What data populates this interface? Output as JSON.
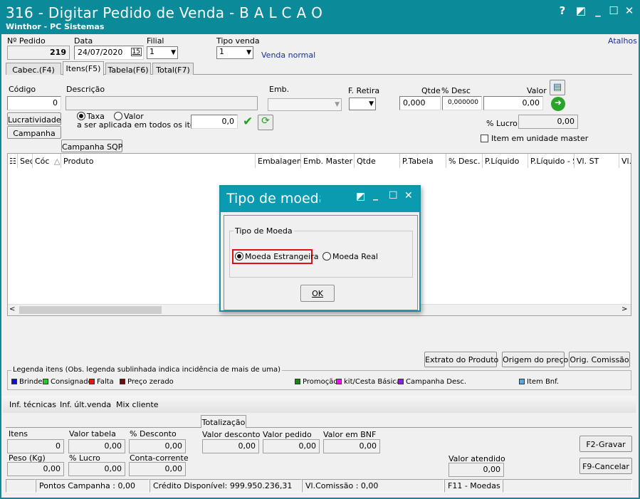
{
  "window": {
    "title": "316 - Digitar Pedido de Venda - B A L C A O",
    "subtitle": "Winthor - PC Sistemas",
    "help_glyph": "?",
    "restore_glyph": "◩",
    "minimize_glyph": "_",
    "maximize_glyph": "☐",
    "close_glyph": "✕"
  },
  "header": {
    "pedido_label": "Nº Pedido",
    "pedido_value": "219",
    "data_label": "Data",
    "data_value": "24/07/2020",
    "calendar_glyph": "15",
    "filial_label": "Filial",
    "filial_value": "1",
    "tipo_venda_label": "Tipo venda",
    "tipo_venda_value": "1",
    "tipo_venda_desc": "Venda normal",
    "atalhos": "Atalhos"
  },
  "tabs": [
    {
      "label": "Cabec.(F4)"
    },
    {
      "label": "Itens(F5)"
    },
    {
      "label": "Tabela(F6)"
    },
    {
      "label": "Total(F7)"
    }
  ],
  "item_form": {
    "codigo_label": "Código",
    "codigo_value": "0",
    "descricao_label": "Descrição",
    "emb_label": "Emb.",
    "f_retira_label": "F. Retira",
    "qtde_label": "Qtde",
    "qtde_value": "0,000",
    "desc_label": "% Desc",
    "desc_value": "0,000000",
    "valor_label": "Valor",
    "valor_value": "0,00",
    "lucro_label": "% Lucro:",
    "lucro_value": "0,00",
    "item_master_label": "Item em unidade master",
    "lucratividade_button": "Lucratividade",
    "campanha_button": "Campanha",
    "campanha_sqp_button": "Campanha SQP",
    "taxa_label": "Taxa",
    "valor_radio_label": "Valor",
    "aplicada_label": "a ser aplicada em todos os itens:",
    "taxa_value": "0,0",
    "check_glyph": "✔",
    "refresh_glyph": "⟳",
    "copy_glyph": "▤",
    "go_glyph": "➜"
  },
  "grid": {
    "columns": [
      "Sec",
      "Cóc",
      "Produto",
      "Embalagem",
      "Emb. Master",
      "Qtde",
      "P.Tabela",
      "% Desc.",
      "P.Líquido",
      "P.Líquido - S",
      "Vl. ST",
      "Vl."
    ],
    "sort_glyph": "△",
    "menu_glyph": "☷",
    "scroll_left": "<",
    "scroll_right": ">"
  },
  "actions": {
    "extrato": "Extrato do Produto",
    "origem": "Origem do preço",
    "comissao": "Orig. Comissão"
  },
  "legend": {
    "title": "Legenda itens (Obs. legenda sublinhada indica incidência de mais de uma)",
    "items": [
      {
        "label": "Brinde",
        "color": "#1010d0"
      },
      {
        "label": "Consignado",
        "color": "#22cc22"
      },
      {
        "label": "Falta",
        "color": "#ee1111"
      },
      {
        "label": "Preço zerado",
        "color": "#7a0a0a"
      },
      {
        "label": "Promoção",
        "color": "#118811"
      },
      {
        "label": "kit/Cesta Básica",
        "color": "#ee11ee"
      },
      {
        "label": "Campanha Desc.",
        "color": "#8a22dd"
      },
      {
        "label": "Item Bnf.",
        "color": "#55a8e8"
      }
    ]
  },
  "info_links": [
    "Inf. técnicas",
    "Inf. últ.venda",
    "Mix cliente"
  ],
  "totals": {
    "tab_label": "Totalização",
    "itens_label": "Itens",
    "itens_value": "0",
    "valor_tabela_label": "Valor tabela",
    "valor_tabela_value": "0,00",
    "pct_desconto_label": "% Desconto",
    "pct_desconto_value": "0,00",
    "valor_desconto_label": "Valor desconto",
    "valor_desconto_value": "0,00",
    "valor_pedido_label": "Valor pedido",
    "valor_pedido_value": "0,00",
    "valor_bnf_label": "Valor em BNF",
    "valor_bnf_value": "0,00",
    "peso_label": "Peso (Kg)",
    "peso_value": "0,00",
    "pct_lucro_label": "% Lucro",
    "pct_lucro_value": "0,00",
    "conta_corrente_label": "Conta-corrente",
    "conta_corrente_value": "0,00",
    "valor_atendido_label": "Valor atendido",
    "valor_atendido_value": "0,00",
    "gravar_button": "F2-Gravar",
    "cancelar_button": "F9-Cancelar"
  },
  "status_bar": {
    "pontos": "Pontos Campanha : 0,00",
    "credito": "Crédito Disponível: 999.950.236,31",
    "comissao": "Vl.Comissão : 0,00",
    "moedas": "F11 - Moedas"
  },
  "dialog": {
    "title": "Tipo de moeda",
    "group_label": "Tipo de Moeda",
    "option_estrangeira": "Moeda Estrangeira",
    "option_real": "Moeda Real",
    "selected": "Moeda Estrangeira",
    "ok_button": "OK",
    "highlight_color": "#e01010"
  }
}
